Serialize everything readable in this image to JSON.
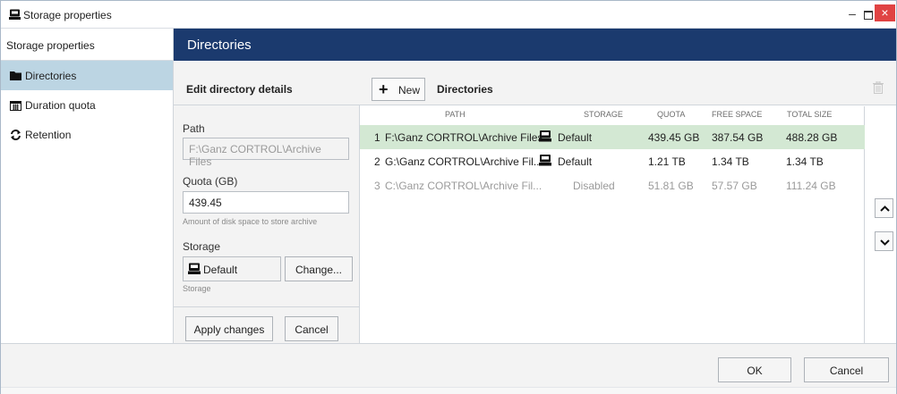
{
  "window": {
    "title": "Storage properties",
    "controls": {
      "minimize": "–",
      "close": "×"
    },
    "close_color": "#e04343"
  },
  "nav": {
    "header": "Storage properties",
    "items": [
      {
        "label": "Directories",
        "icon": "folder-icon",
        "active": true
      },
      {
        "label": "Duration quota",
        "icon": "calendar-icon",
        "active": false
      },
      {
        "label": "Retention",
        "icon": "refresh-icon",
        "active": false
      }
    ]
  },
  "main": {
    "header": "Directories",
    "header_color": "#1b3a6e"
  },
  "edit": {
    "title": "Edit directory details",
    "path_label": "Path",
    "path_value": "F:\\Ganz CORTROL\\Archive Files",
    "quota_label": "Quota (GB)",
    "quota_value": "439.45",
    "quota_hint": "Amount of disk space to store archive",
    "storage_label": "Storage",
    "storage_value": "Default",
    "change_label": "Change...",
    "storage_hint": "Storage",
    "apply_label": "Apply changes",
    "cancel_label": "Cancel"
  },
  "directories": {
    "new_label": "New",
    "title": "Directories",
    "columns": [
      "PATH",
      "STORAGE",
      "QUOTA",
      "FREE SPACE",
      "TOTAL SIZE"
    ],
    "rows": [
      {
        "num": "1",
        "path": "F:\\Ganz CORTROL\\Archive Files",
        "storage": "Default",
        "quota": "439.45 GB",
        "free": "387.54 GB",
        "total": "488.28 GB",
        "selected": true,
        "disabled": false
      },
      {
        "num": "2",
        "path": "G:\\Ganz CORTROL\\Archive Fil...",
        "storage": "Default",
        "quota": "1.21 TB",
        "free": "1.34 TB",
        "total": "1.34 TB",
        "selected": false,
        "disabled": false
      },
      {
        "num": "3",
        "path": "C:\\Ganz CORTROL\\Archive Fil...",
        "storage": "Disabled",
        "quota": "51.81 GB",
        "free": "57.57 GB",
        "total": "111.24 GB",
        "selected": false,
        "disabled": true
      }
    ],
    "selected_color": "#d3e8d3"
  },
  "footer": {
    "ok_label": "OK",
    "cancel_label": "Cancel"
  }
}
